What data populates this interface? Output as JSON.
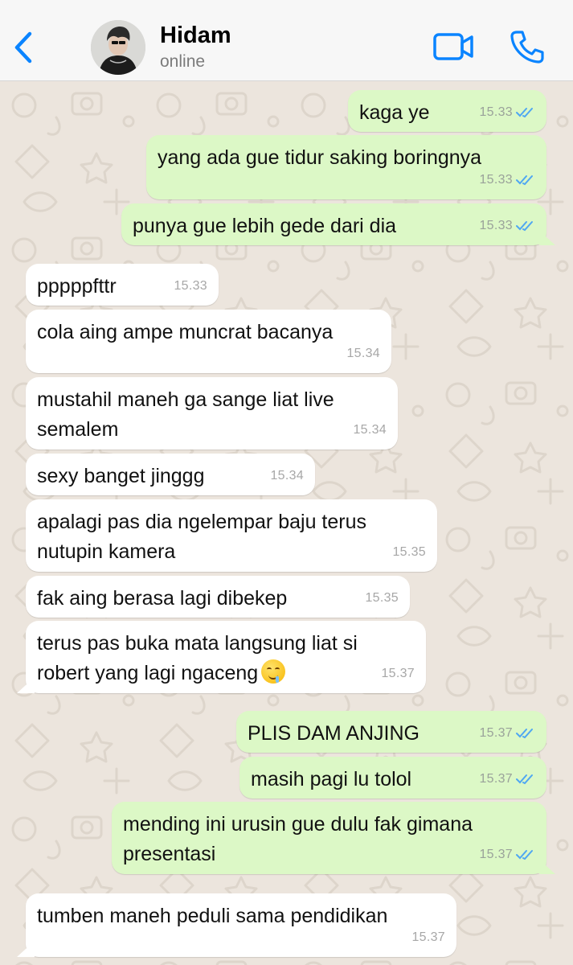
{
  "header": {
    "contact_name": "Hidam",
    "contact_status": "online",
    "back_icon": "chevron-left-icon",
    "video_icon": "video-camera-icon",
    "call_icon": "phone-icon",
    "accent_color": "#0a84ff"
  },
  "messages": [
    {
      "direction": "outgoing",
      "text": "kaga ye",
      "time": "15.33",
      "read": true
    },
    {
      "direction": "outgoing",
      "text": "yang ada gue tidur saking boringnya",
      "time": "15.33",
      "read": true
    },
    {
      "direction": "outgoing",
      "text": "punya gue lebih gede dari dia",
      "time": "15.33",
      "read": true
    },
    {
      "direction": "incoming",
      "text": "pppppfttr",
      "time": "15.33"
    },
    {
      "direction": "incoming",
      "text": "cola aing ampe muncrat bacanya",
      "time": "15.34"
    },
    {
      "direction": "incoming",
      "text": "mustahil maneh ga sange liat live\nsemalem",
      "time": "15.34"
    },
    {
      "direction": "incoming",
      "text": "sexy banget jinggg",
      "time": "15.34"
    },
    {
      "direction": "incoming",
      "text": "apalagi pas dia ngelempar baju terus\nnutupin kamera",
      "time": "15.35"
    },
    {
      "direction": "incoming",
      "text": "fak aing berasa lagi dibekep",
      "time": "15.35"
    },
    {
      "direction": "incoming",
      "text": "terus pas buka mata langsung liat si\nrobert yang lagi ngaceng",
      "emoji": "drooling-face-emoji",
      "time": "15.37"
    },
    {
      "direction": "outgoing",
      "text": "PLIS DAM ANJING",
      "time": "15.37",
      "read": true
    },
    {
      "direction": "outgoing",
      "text": "masih pagi lu tolol",
      "time": "15.37",
      "read": true
    },
    {
      "direction": "outgoing",
      "text": "mending ini urusin gue dulu fak gimana\npresentasi",
      "time": "15.37",
      "read": true
    },
    {
      "direction": "incoming",
      "text": "tumben maneh peduli sama pendidikan",
      "time": "15.37"
    }
  ],
  "colors": {
    "outgoing_bubble": "#dcf8c6",
    "incoming_bubble": "#ffffff",
    "wallpaper": "#ece5dd",
    "read_ticks": "#4fa7f2"
  }
}
